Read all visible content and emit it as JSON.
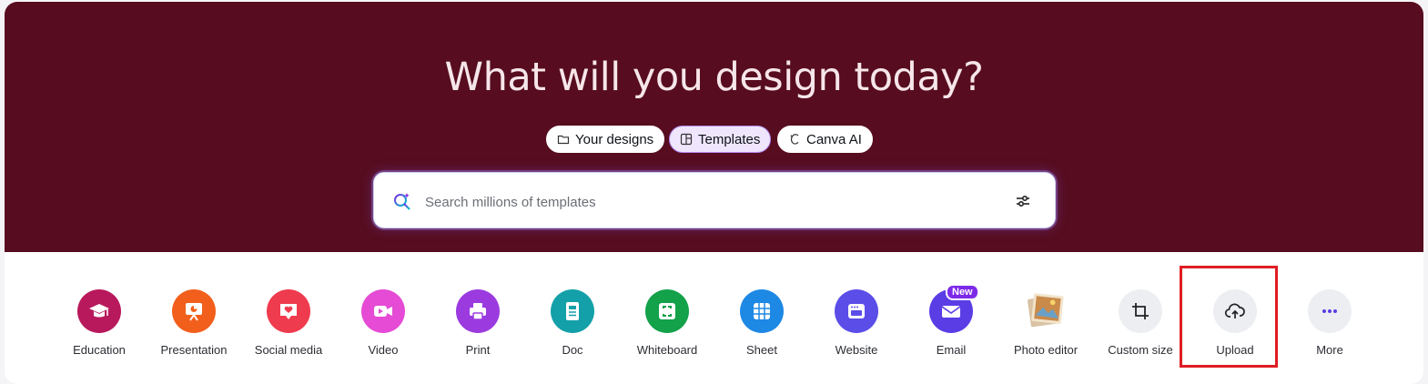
{
  "hero": {
    "title": "What will you design today?"
  },
  "tabs": [
    {
      "label": "Your designs",
      "icon": "folder-icon"
    },
    {
      "label": "Templates",
      "icon": "template-icon",
      "active": true
    },
    {
      "label": "Canva AI",
      "icon": "canva-ai-icon"
    }
  ],
  "search": {
    "placeholder": "Search millions of templates",
    "value": ""
  },
  "categories": [
    {
      "label": "Education",
      "icon": "graduation-cap-icon",
      "color": "#b8195c"
    },
    {
      "label": "Presentation",
      "icon": "presentation-icon",
      "color": "#f25f1c"
    },
    {
      "label": "Social media",
      "icon": "heart-chat-icon",
      "color": "#ef3b4e"
    },
    {
      "label": "Video",
      "icon": "video-icon",
      "color": "#e54bd5"
    },
    {
      "label": "Print",
      "icon": "printer-icon",
      "color": "#9b3bdf"
    },
    {
      "label": "Doc",
      "icon": "doc-icon",
      "color": "#14a0a8"
    },
    {
      "label": "Whiteboard",
      "icon": "whiteboard-icon",
      "color": "#13a14a"
    },
    {
      "label": "Sheet",
      "icon": "sheet-icon",
      "color": "#1e88e5"
    },
    {
      "label": "Website",
      "icon": "website-icon",
      "color": "#5b4de8"
    },
    {
      "label": "Email",
      "icon": "email-icon",
      "color": "#5b3de6",
      "badge": "New"
    },
    {
      "label": "Photo editor",
      "icon": "photo-editor-icon",
      "color": "#c9a47a"
    },
    {
      "label": "Custom size",
      "icon": "custom-size-icon",
      "color": "#eceef1"
    },
    {
      "label": "Upload",
      "icon": "upload-cloud-icon",
      "color": "#eceef1"
    },
    {
      "label": "More",
      "icon": "more-dots-icon",
      "color": "#eceef1"
    }
  ]
}
